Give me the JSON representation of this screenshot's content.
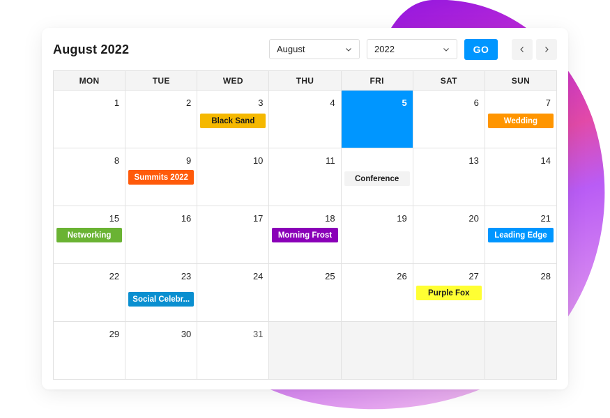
{
  "header": {
    "title": "August 2022",
    "month_select": {
      "value": "August"
    },
    "year_select": {
      "value": "2022"
    },
    "go_label": "GO",
    "prev_icon": "chevron-left-icon",
    "next_icon": "chevron-right-icon"
  },
  "colors": {
    "accent": "#0096ff",
    "today_bg": "#0096ff",
    "header_bg": "#f4f4f4",
    "blob_gradient": [
      "#8a12e0",
      "#c42fd6",
      "#e24aa8",
      "#b95cf5",
      "#e8a4ee"
    ]
  },
  "weekdays": [
    "MON",
    "TUE",
    "WED",
    "THU",
    "FRI",
    "SAT",
    "SUN"
  ],
  "weeks": [
    [
      {
        "day": "1"
      },
      {
        "day": "2"
      },
      {
        "day": "3",
        "event": {
          "label": "Black Sand",
          "bg": "#f5b800",
          "fg": "#1a1a1a"
        }
      },
      {
        "day": "4"
      },
      {
        "day": "5",
        "today": true
      },
      {
        "day": "6"
      },
      {
        "day": "7",
        "event": {
          "label": "Wedding",
          "bg": "#ff9500",
          "fg": "#ffffff"
        }
      }
    ],
    [
      {
        "day": "8"
      },
      {
        "day": "9",
        "event": {
          "label": "Summits 2022",
          "bg": "#ff5a0a",
          "fg": "#ffffff"
        }
      },
      {
        "day": "10"
      },
      {
        "day": "11"
      },
      {
        "day": "",
        "event": {
          "label": "Conference",
          "bg": "#f3f3f3",
          "fg": "#1a1a1a"
        }
      },
      {
        "day": "13"
      },
      {
        "day": "14"
      }
    ],
    [
      {
        "day": "15",
        "event": {
          "label": "Networking",
          "bg": "#6ab333",
          "fg": "#ffffff"
        }
      },
      {
        "day": "16"
      },
      {
        "day": "17"
      },
      {
        "day": "18",
        "event": {
          "label": "Morning Frost",
          "bg": "#8a00b8",
          "fg": "#ffffff"
        }
      },
      {
        "day": "19"
      },
      {
        "day": "20"
      },
      {
        "day": "21",
        "event": {
          "label": "Leading Edge",
          "bg": "#0096ff",
          "fg": "#ffffff"
        }
      }
    ],
    [
      {
        "day": "22"
      },
      {
        "day": "23",
        "event": {
          "label": "Social Celebr...",
          "bg": "#0a8fd0",
          "fg": "#ffffff"
        }
      },
      {
        "day": "24"
      },
      {
        "day": "25"
      },
      {
        "day": "26"
      },
      {
        "day": "27",
        "event": {
          "label": "Purple Fox",
          "bg": "#ffff33",
          "fg": "#1a1a1a"
        }
      },
      {
        "day": "28"
      }
    ],
    [
      {
        "day": "29"
      },
      {
        "day": "30"
      },
      {
        "day": "31",
        "muted": true
      },
      {
        "day": "",
        "empty": true
      },
      {
        "day": "",
        "empty": true
      },
      {
        "day": "",
        "empty": true
      },
      {
        "day": "",
        "empty": true
      }
    ]
  ]
}
